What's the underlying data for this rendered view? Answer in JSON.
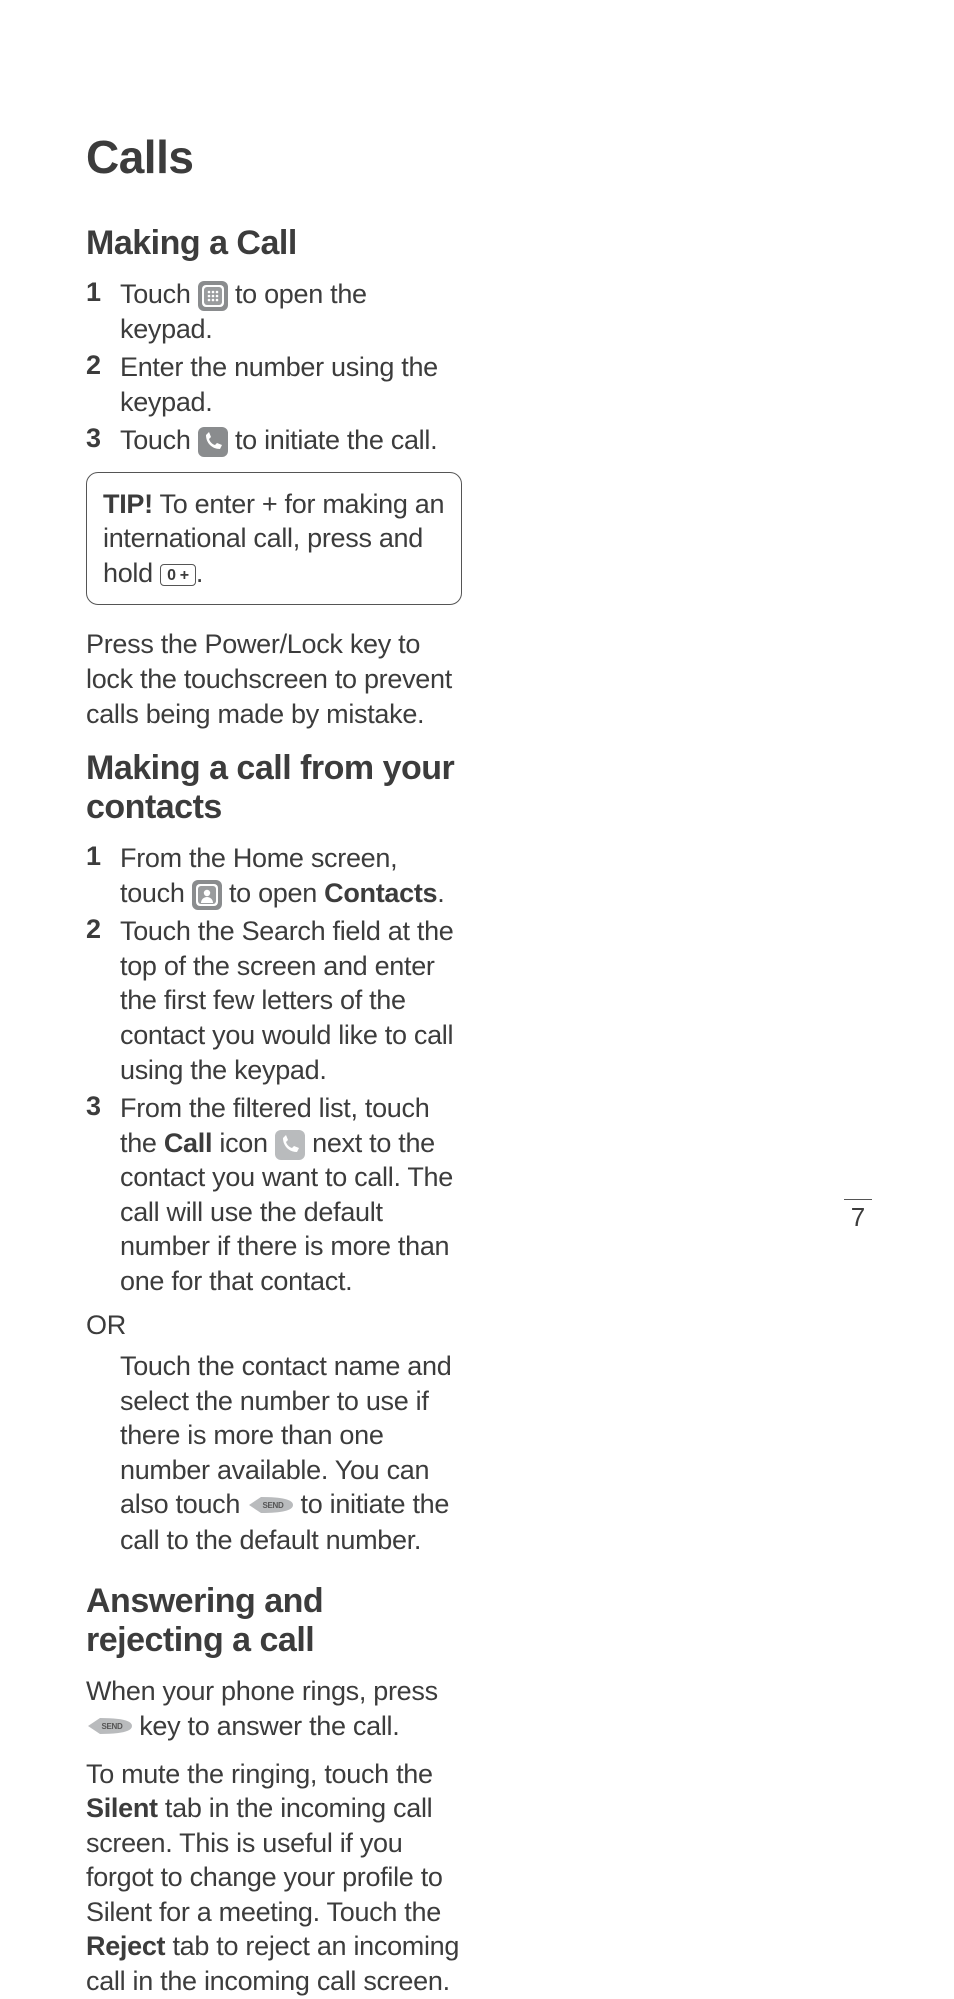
{
  "pageTitle": "Calls",
  "pageNum": "7",
  "sections": {
    "s1": {
      "title": "Making a Call",
      "item1_a": "Touch ",
      "item1_b": " to open the keypad.",
      "item2": "Enter the number using the keypad.",
      "item3_a": "Touch ",
      "item3_b": " to initiate the call.",
      "tip_bold": "TIP!",
      "tip_a": " To enter + for making an international call, press and hold ",
      "tip_key": "0 +",
      "tip_b": ".",
      "para": "Press the Power/Lock key to lock the touchscreen to prevent calls being made by mistake."
    },
    "s2": {
      "title": "Making a call from your contacts",
      "item1_a": "From the Home screen, touch ",
      "item1_b": " to open ",
      "item1_bold": "Contacts",
      "item1_c": ".",
      "item2": "Touch the Search field at the top of the screen and enter the first few letters of the contact you would like to call using the keypad.",
      "item3_a": "From the filtered list, touch the ",
      "item3_bold": "Call",
      "item3_b": " icon ",
      "item3_c": " next to the contact you want to call. The call will use the default number if there is more than one for that contact.",
      "or": "OR",
      "or_a": "Touch the contact name and select the number to use if there is more than one number available. You can also touch ",
      "or_b": " to initiate the call to the default number."
    },
    "s3": {
      "title": "Answering and rejecting a call",
      "p1_a": "When your phone rings, press ",
      "p1_b": " key to answer the call.",
      "p2_a": "To mute the ringing, touch the ",
      "p2_bold1": "Silent",
      "p2_b": " tab in the incoming call screen. This is useful if you forgot to change your profile to Silent for a meeting. Touch the ",
      "p2_bold2": "Reject",
      "p2_c": " tab to reject an incoming call in the incoming call screen."
    }
  },
  "nums": {
    "n1": "1",
    "n2": "2",
    "n3": "3"
  }
}
